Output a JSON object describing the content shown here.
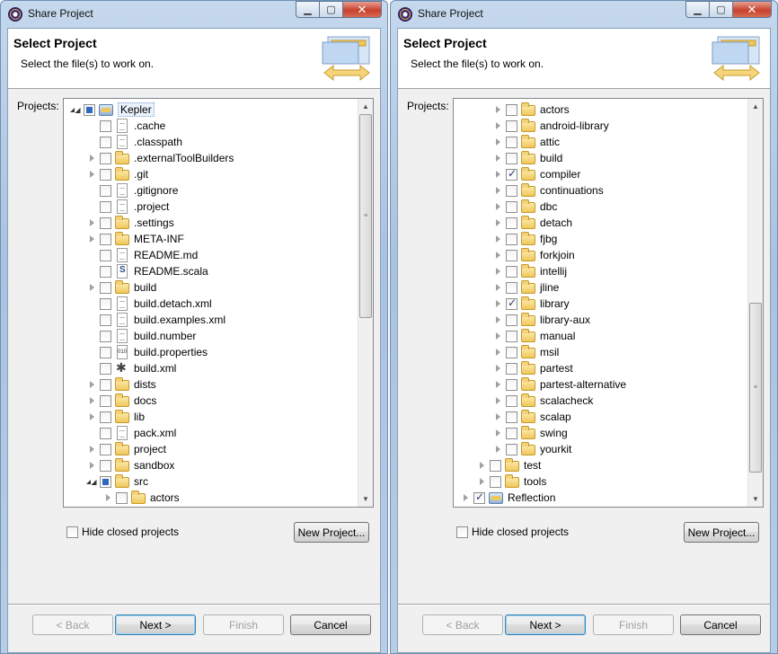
{
  "dialog": {
    "title": "Share Project",
    "header_title": "Select Project",
    "header_desc": "Select the file(s) to work on.",
    "projects_label": "Projects:",
    "hide_closed_label": "Hide closed projects",
    "new_project_label": "New Project...",
    "back_label": "< Back",
    "next_label": "Next >",
    "finish_label": "Finish",
    "cancel_label": "Cancel"
  },
  "left_tree": [
    {
      "label": "Kepler",
      "indent": 0,
      "twisty": "expanded",
      "check": "partial",
      "icon": "project",
      "selected": true
    },
    {
      "label": ".cache",
      "indent": 1,
      "twisty": "none",
      "check": "unchecked",
      "icon": "file"
    },
    {
      "label": ".classpath",
      "indent": 1,
      "twisty": "none",
      "check": "unchecked",
      "icon": "file"
    },
    {
      "label": ".externalToolBuilders",
      "indent": 1,
      "twisty": "collapsed",
      "check": "unchecked",
      "icon": "folder"
    },
    {
      "label": ".git",
      "indent": 1,
      "twisty": "collapsed",
      "check": "unchecked",
      "icon": "folder"
    },
    {
      "label": ".gitignore",
      "indent": 1,
      "twisty": "none",
      "check": "unchecked",
      "icon": "file"
    },
    {
      "label": ".project",
      "indent": 1,
      "twisty": "none",
      "check": "unchecked",
      "icon": "file"
    },
    {
      "label": ".settings",
      "indent": 1,
      "twisty": "collapsed",
      "check": "unchecked",
      "icon": "folder"
    },
    {
      "label": "META-INF",
      "indent": 1,
      "twisty": "collapsed",
      "check": "unchecked",
      "icon": "folder"
    },
    {
      "label": "README.md",
      "indent": 1,
      "twisty": "none",
      "check": "unchecked",
      "icon": "file"
    },
    {
      "label": "README.scala",
      "indent": 1,
      "twisty": "none",
      "check": "unchecked",
      "icon": "scala"
    },
    {
      "label": "build",
      "indent": 1,
      "twisty": "collapsed",
      "check": "unchecked",
      "icon": "folder"
    },
    {
      "label": "build.detach.xml",
      "indent": 1,
      "twisty": "none",
      "check": "unchecked",
      "icon": "file"
    },
    {
      "label": "build.examples.xml",
      "indent": 1,
      "twisty": "none",
      "check": "unchecked",
      "icon": "file"
    },
    {
      "label": "build.number",
      "indent": 1,
      "twisty": "none",
      "check": "unchecked",
      "icon": "file"
    },
    {
      "label": "build.properties",
      "indent": 1,
      "twisty": "none",
      "check": "unchecked",
      "icon": "props"
    },
    {
      "label": "build.xml",
      "indent": 1,
      "twisty": "none",
      "check": "unchecked",
      "icon": "ant"
    },
    {
      "label": "dists",
      "indent": 1,
      "twisty": "collapsed",
      "check": "unchecked",
      "icon": "folder"
    },
    {
      "label": "docs",
      "indent": 1,
      "twisty": "collapsed",
      "check": "unchecked",
      "icon": "folder"
    },
    {
      "label": "lib",
      "indent": 1,
      "twisty": "collapsed",
      "check": "unchecked",
      "icon": "folder"
    },
    {
      "label": "pack.xml",
      "indent": 1,
      "twisty": "none",
      "check": "unchecked",
      "icon": "file"
    },
    {
      "label": "project",
      "indent": 1,
      "twisty": "collapsed",
      "check": "unchecked",
      "icon": "folder"
    },
    {
      "label": "sandbox",
      "indent": 1,
      "twisty": "collapsed",
      "check": "unchecked",
      "icon": "folder"
    },
    {
      "label": "src",
      "indent": 1,
      "twisty": "expanded",
      "check": "partial",
      "icon": "folder"
    },
    {
      "label": "actors",
      "indent": 2,
      "twisty": "collapsed",
      "check": "unchecked",
      "icon": "folder"
    }
  ],
  "right_tree": [
    {
      "label": "actors",
      "indent": 2,
      "twisty": "collapsed",
      "check": "unchecked",
      "icon": "folder"
    },
    {
      "label": "android-library",
      "indent": 2,
      "twisty": "collapsed",
      "check": "unchecked",
      "icon": "folder"
    },
    {
      "label": "attic",
      "indent": 2,
      "twisty": "collapsed",
      "check": "unchecked",
      "icon": "folder"
    },
    {
      "label": "build",
      "indent": 2,
      "twisty": "collapsed",
      "check": "unchecked",
      "icon": "folder"
    },
    {
      "label": "compiler",
      "indent": 2,
      "twisty": "collapsed",
      "check": "checked",
      "icon": "folder"
    },
    {
      "label": "continuations",
      "indent": 2,
      "twisty": "collapsed",
      "check": "unchecked",
      "icon": "folder"
    },
    {
      "label": "dbc",
      "indent": 2,
      "twisty": "collapsed",
      "check": "unchecked",
      "icon": "folder"
    },
    {
      "label": "detach",
      "indent": 2,
      "twisty": "collapsed",
      "check": "unchecked",
      "icon": "folder"
    },
    {
      "label": "fjbg",
      "indent": 2,
      "twisty": "collapsed",
      "check": "unchecked",
      "icon": "folder"
    },
    {
      "label": "forkjoin",
      "indent": 2,
      "twisty": "collapsed",
      "check": "unchecked",
      "icon": "folder"
    },
    {
      "label": "intellij",
      "indent": 2,
      "twisty": "collapsed",
      "check": "unchecked",
      "icon": "folder"
    },
    {
      "label": "jline",
      "indent": 2,
      "twisty": "collapsed",
      "check": "unchecked",
      "icon": "folder"
    },
    {
      "label": "library",
      "indent": 2,
      "twisty": "collapsed",
      "check": "checked",
      "icon": "folder"
    },
    {
      "label": "library-aux",
      "indent": 2,
      "twisty": "collapsed",
      "check": "unchecked",
      "icon": "folder"
    },
    {
      "label": "manual",
      "indent": 2,
      "twisty": "collapsed",
      "check": "unchecked",
      "icon": "folder"
    },
    {
      "label": "msil",
      "indent": 2,
      "twisty": "collapsed",
      "check": "unchecked",
      "icon": "folder"
    },
    {
      "label": "partest",
      "indent": 2,
      "twisty": "collapsed",
      "check": "unchecked",
      "icon": "folder"
    },
    {
      "label": "partest-alternative",
      "indent": 2,
      "twisty": "collapsed",
      "check": "unchecked",
      "icon": "folder"
    },
    {
      "label": "scalacheck",
      "indent": 2,
      "twisty": "collapsed",
      "check": "unchecked",
      "icon": "folder"
    },
    {
      "label": "scalap",
      "indent": 2,
      "twisty": "collapsed",
      "check": "unchecked",
      "icon": "folder"
    },
    {
      "label": "swing",
      "indent": 2,
      "twisty": "collapsed",
      "check": "unchecked",
      "icon": "folder"
    },
    {
      "label": "yourkit",
      "indent": 2,
      "twisty": "collapsed",
      "check": "unchecked",
      "icon": "folder"
    },
    {
      "label": "test",
      "indent": 1,
      "twisty": "collapsed",
      "check": "unchecked",
      "icon": "folder"
    },
    {
      "label": "tools",
      "indent": 1,
      "twisty": "collapsed",
      "check": "unchecked",
      "icon": "folder"
    },
    {
      "label": "Reflection",
      "indent": 0,
      "twisty": "collapsed",
      "check": "checked",
      "icon": "project"
    }
  ],
  "left_scroll": {
    "thumb_start_fraction": 0.0,
    "thumb_size_fraction": 0.54
  },
  "right_scroll": {
    "thumb_start_fraction": 0.5,
    "thumb_size_fraction": 0.45
  }
}
